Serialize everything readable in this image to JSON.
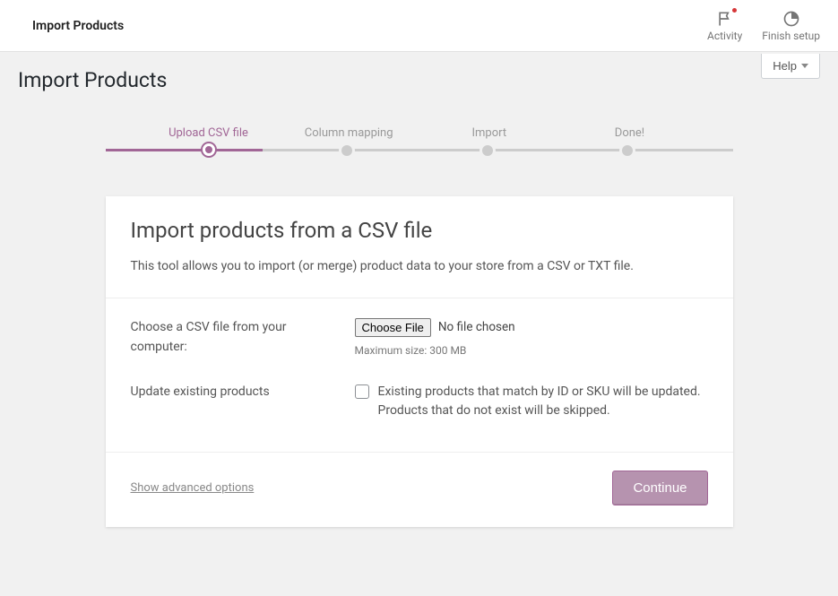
{
  "topbar": {
    "title": "Import Products",
    "activity_label": "Activity",
    "finish_label": "Finish setup"
  },
  "help_label": "Help",
  "page_heading": "Import Products",
  "steps": {
    "s1": "Upload CSV file",
    "s2": "Column mapping",
    "s3": "Import",
    "s4": "Done!"
  },
  "panel": {
    "heading": "Import products from a CSV file",
    "intro": "This tool allows you to import (or merge) product data to your store from a CSV or TXT file.",
    "choose_label": "Choose a CSV file from your computer:",
    "choose_button": "Choose File",
    "no_file": "No file chosen",
    "max_size": "Maximum size: 300 MB",
    "update_label": "Update existing products",
    "update_desc": "Existing products that match by ID or SKU will be updated. Products that do not exist will be skipped.",
    "advanced_link": "Show advanced options",
    "continue": "Continue"
  }
}
